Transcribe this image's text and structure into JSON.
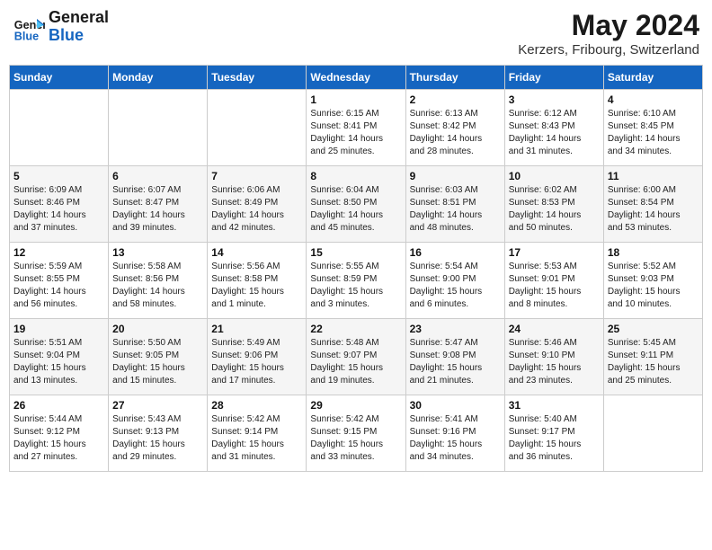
{
  "header": {
    "logo_line1": "General",
    "logo_line2": "Blue",
    "title": "May 2024",
    "subtitle": "Kerzers, Fribourg, Switzerland"
  },
  "days_of_week": [
    "Sunday",
    "Monday",
    "Tuesday",
    "Wednesday",
    "Thursday",
    "Friday",
    "Saturday"
  ],
  "weeks": [
    [
      {
        "day": "",
        "info": ""
      },
      {
        "day": "",
        "info": ""
      },
      {
        "day": "",
        "info": ""
      },
      {
        "day": "1",
        "info": "Sunrise: 6:15 AM\nSunset: 8:41 PM\nDaylight: 14 hours\nand 25 minutes."
      },
      {
        "day": "2",
        "info": "Sunrise: 6:13 AM\nSunset: 8:42 PM\nDaylight: 14 hours\nand 28 minutes."
      },
      {
        "day": "3",
        "info": "Sunrise: 6:12 AM\nSunset: 8:43 PM\nDaylight: 14 hours\nand 31 minutes."
      },
      {
        "day": "4",
        "info": "Sunrise: 6:10 AM\nSunset: 8:45 PM\nDaylight: 14 hours\nand 34 minutes."
      }
    ],
    [
      {
        "day": "5",
        "info": "Sunrise: 6:09 AM\nSunset: 8:46 PM\nDaylight: 14 hours\nand 37 minutes."
      },
      {
        "day": "6",
        "info": "Sunrise: 6:07 AM\nSunset: 8:47 PM\nDaylight: 14 hours\nand 39 minutes."
      },
      {
        "day": "7",
        "info": "Sunrise: 6:06 AM\nSunset: 8:49 PM\nDaylight: 14 hours\nand 42 minutes."
      },
      {
        "day": "8",
        "info": "Sunrise: 6:04 AM\nSunset: 8:50 PM\nDaylight: 14 hours\nand 45 minutes."
      },
      {
        "day": "9",
        "info": "Sunrise: 6:03 AM\nSunset: 8:51 PM\nDaylight: 14 hours\nand 48 minutes."
      },
      {
        "day": "10",
        "info": "Sunrise: 6:02 AM\nSunset: 8:53 PM\nDaylight: 14 hours\nand 50 minutes."
      },
      {
        "day": "11",
        "info": "Sunrise: 6:00 AM\nSunset: 8:54 PM\nDaylight: 14 hours\nand 53 minutes."
      }
    ],
    [
      {
        "day": "12",
        "info": "Sunrise: 5:59 AM\nSunset: 8:55 PM\nDaylight: 14 hours\nand 56 minutes."
      },
      {
        "day": "13",
        "info": "Sunrise: 5:58 AM\nSunset: 8:56 PM\nDaylight: 14 hours\nand 58 minutes."
      },
      {
        "day": "14",
        "info": "Sunrise: 5:56 AM\nSunset: 8:58 PM\nDaylight: 15 hours\nand 1 minute."
      },
      {
        "day": "15",
        "info": "Sunrise: 5:55 AM\nSunset: 8:59 PM\nDaylight: 15 hours\nand 3 minutes."
      },
      {
        "day": "16",
        "info": "Sunrise: 5:54 AM\nSunset: 9:00 PM\nDaylight: 15 hours\nand 6 minutes."
      },
      {
        "day": "17",
        "info": "Sunrise: 5:53 AM\nSunset: 9:01 PM\nDaylight: 15 hours\nand 8 minutes."
      },
      {
        "day": "18",
        "info": "Sunrise: 5:52 AM\nSunset: 9:03 PM\nDaylight: 15 hours\nand 10 minutes."
      }
    ],
    [
      {
        "day": "19",
        "info": "Sunrise: 5:51 AM\nSunset: 9:04 PM\nDaylight: 15 hours\nand 13 minutes."
      },
      {
        "day": "20",
        "info": "Sunrise: 5:50 AM\nSunset: 9:05 PM\nDaylight: 15 hours\nand 15 minutes."
      },
      {
        "day": "21",
        "info": "Sunrise: 5:49 AM\nSunset: 9:06 PM\nDaylight: 15 hours\nand 17 minutes."
      },
      {
        "day": "22",
        "info": "Sunrise: 5:48 AM\nSunset: 9:07 PM\nDaylight: 15 hours\nand 19 minutes."
      },
      {
        "day": "23",
        "info": "Sunrise: 5:47 AM\nSunset: 9:08 PM\nDaylight: 15 hours\nand 21 minutes."
      },
      {
        "day": "24",
        "info": "Sunrise: 5:46 AM\nSunset: 9:10 PM\nDaylight: 15 hours\nand 23 minutes."
      },
      {
        "day": "25",
        "info": "Sunrise: 5:45 AM\nSunset: 9:11 PM\nDaylight: 15 hours\nand 25 minutes."
      }
    ],
    [
      {
        "day": "26",
        "info": "Sunrise: 5:44 AM\nSunset: 9:12 PM\nDaylight: 15 hours\nand 27 minutes."
      },
      {
        "day": "27",
        "info": "Sunrise: 5:43 AM\nSunset: 9:13 PM\nDaylight: 15 hours\nand 29 minutes."
      },
      {
        "day": "28",
        "info": "Sunrise: 5:42 AM\nSunset: 9:14 PM\nDaylight: 15 hours\nand 31 minutes."
      },
      {
        "day": "29",
        "info": "Sunrise: 5:42 AM\nSunset: 9:15 PM\nDaylight: 15 hours\nand 33 minutes."
      },
      {
        "day": "30",
        "info": "Sunrise: 5:41 AM\nSunset: 9:16 PM\nDaylight: 15 hours\nand 34 minutes."
      },
      {
        "day": "31",
        "info": "Sunrise: 5:40 AM\nSunset: 9:17 PM\nDaylight: 15 hours\nand 36 minutes."
      },
      {
        "day": "",
        "info": ""
      }
    ]
  ]
}
